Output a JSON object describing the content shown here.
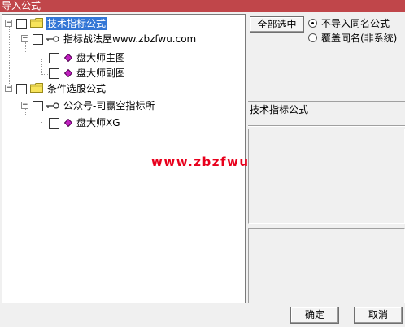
{
  "window": {
    "title": "导入公式"
  },
  "tree": {
    "nodes": [
      {
        "label": "技术指标公式",
        "type": "folder",
        "expanded": true,
        "selected": true
      },
      {
        "label": "指标战法屋www.zbzfwu.com",
        "type": "group",
        "expanded": true
      },
      {
        "label": "盘大师主图",
        "type": "formula"
      },
      {
        "label": "盘大师副图",
        "type": "formula"
      },
      {
        "label": "条件选股公式",
        "type": "folder",
        "expanded": true
      },
      {
        "label": "公众号-司赢空指标所",
        "type": "group",
        "expanded": true
      },
      {
        "label": "盘大师XG",
        "type": "formula"
      }
    ]
  },
  "watermark": "www.zbzfwu.com",
  "options": {
    "select_all_label": "全部选中",
    "radio_skip_label": "不导入同名公式",
    "radio_overwrite_label": "覆盖同名(非系统)",
    "selected_radio": "skip"
  },
  "detail": {
    "category_label": "技术指标公式"
  },
  "footer": {
    "ok_label": "确定",
    "cancel_label": "取消"
  },
  "colors": {
    "title_bar": "#c0464a",
    "selection": "#3376d6",
    "watermark": "#e8001c"
  }
}
